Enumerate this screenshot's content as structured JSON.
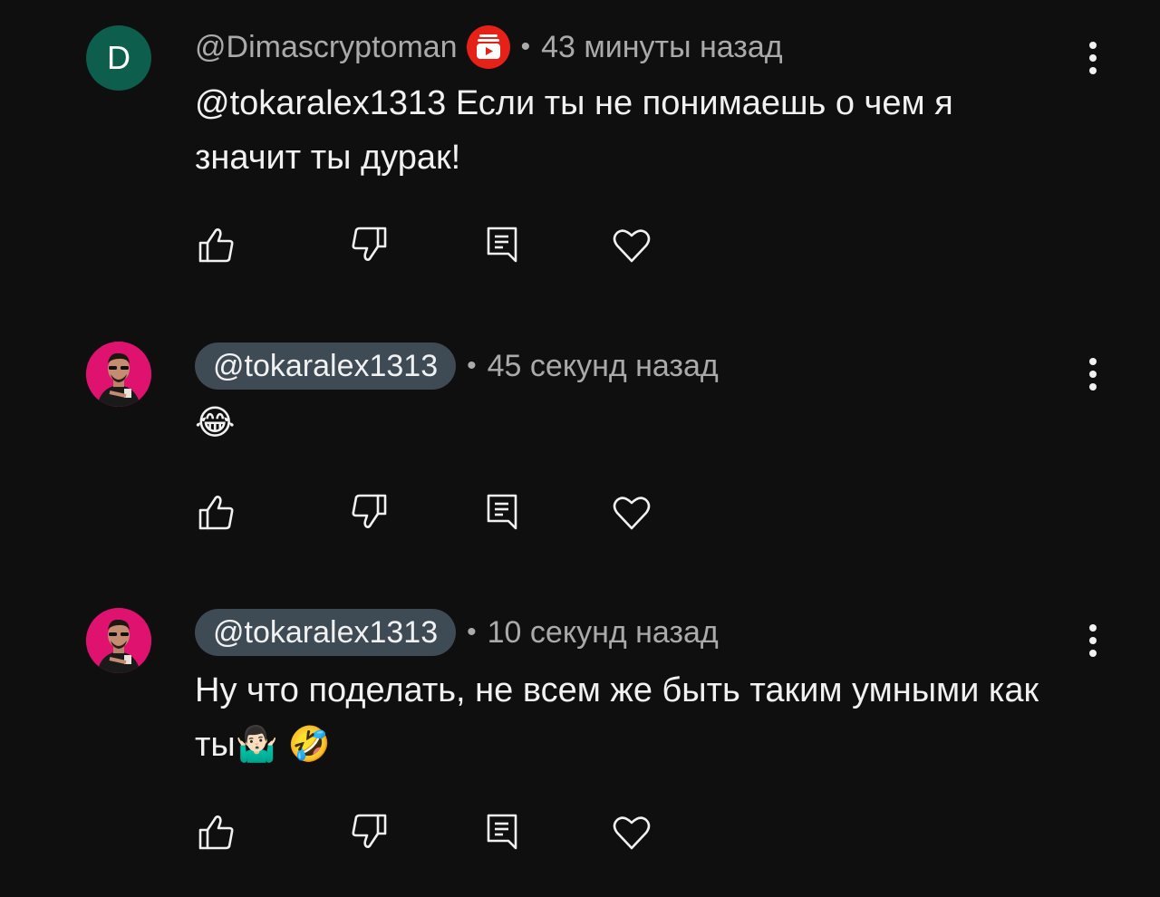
{
  "comments": [
    {
      "avatar_letter": "D",
      "avatar_color": "#0d5e4c",
      "author": "@Dimascryptoman",
      "author_style": "plain",
      "has_badge": true,
      "separator": "•",
      "time": "43 минуты назад",
      "text": "@tokaralex1313 Если ты не понимаешь о чем я значит ты дурак!"
    },
    {
      "avatar_letter": "",
      "avatar_color": "#e0126f",
      "author": "@tokaralex1313",
      "author_style": "chip",
      "has_badge": false,
      "separator": "•",
      "time": "45 секунд назад",
      "text": "😂"
    },
    {
      "avatar_letter": "",
      "avatar_color": "#e0126f",
      "author": "@tokaralex1313",
      "author_style": "chip",
      "has_badge": false,
      "separator": "•",
      "time": "10 секунд назад",
      "text": "Ну что поделать, не всем же быть таким умными как ты🤷🏻‍♂️ 🤣"
    }
  ],
  "icons": {
    "like": "thumbs-up-icon",
    "dislike": "thumbs-down-icon",
    "reply": "reply-icon",
    "heart": "heart-icon",
    "menu": "more-vertical-icon",
    "badge": "youtube-membership-badge-icon"
  },
  "colors": {
    "background": "#0f0f0f",
    "text_primary": "#f1f1f1",
    "text_secondary": "#aaaaaa",
    "author_chip": "#3e4a54",
    "badge_red": "#e62117"
  }
}
